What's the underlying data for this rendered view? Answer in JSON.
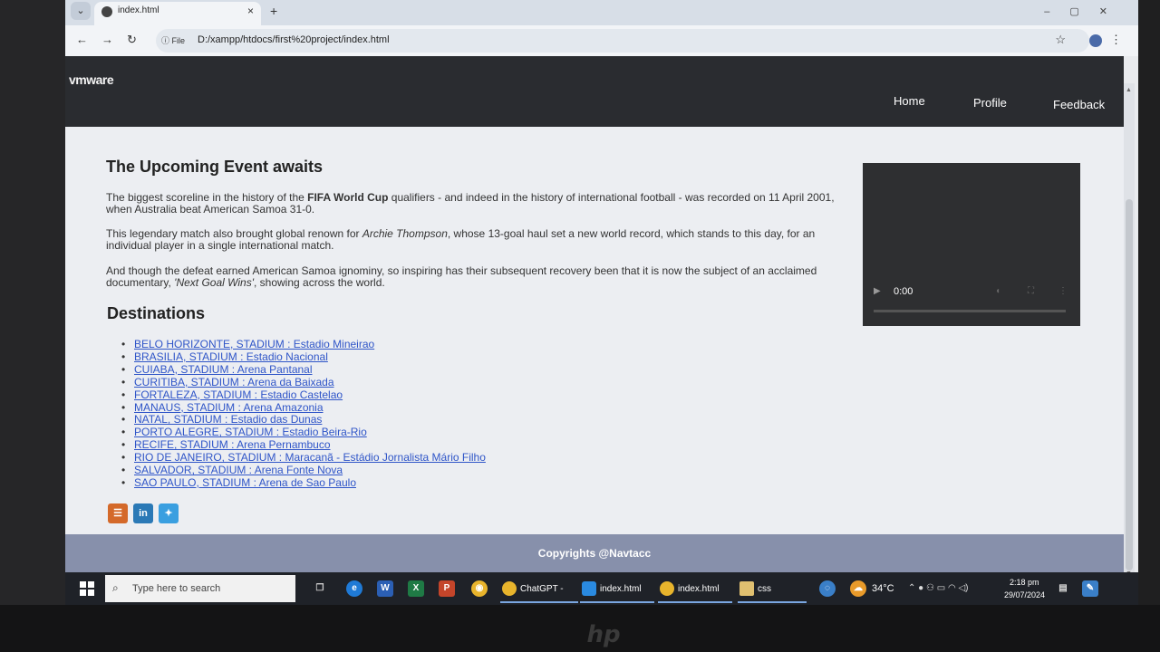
{
  "browser": {
    "tab_title": "index.html",
    "new_tab": "+",
    "close_tab": "×",
    "site_info": "File",
    "url": "D:/xampp/htdocs/first%20project/index.html"
  },
  "site": {
    "brand": "vmware",
    "nav": [
      "Home",
      "Profile",
      "Feedback"
    ],
    "event_title": "The Upcoming Event awaits",
    "para1_a": "The biggest scoreline in the history of the ",
    "para1_b": "FIFA World Cup",
    "para1_c": " qualifiers - and indeed in the history of international football - was recorded on 11 April 2001, when Australia beat American Samoa 31-0.",
    "para2_a": "This legendary match also brought global renown for ",
    "para2_b": "Archie Thompson",
    "para2_c": ", whose 13-goal haul set a new world record, which stands to this day, for an individual player in a single international match.",
    "para3_a": "And though the defeat earned American Samoa ignominy, so inspiring has their subsequent recovery been that it is now the subject of an acclaimed documentary, ",
    "para3_b": "'Next Goal Wins'",
    "para3_c": ", showing across the world.",
    "dest_title": "Destinations",
    "destinations": [
      "BELO HORIZONTE, STADIUM : Estadio Mineirao",
      "BRASILIA, STADIUM : Estadio Nacional",
      "CUIABA, STADIUM : Arena Pantanal",
      "CURITIBA, STADIUM : Arena da Baixada",
      "FORTALEZA, STADIUM : Estadio Castelao",
      "MANAUS, STADIUM : Arena Amazonia",
      "NATAL, STADIUM : Estadio das Dunas",
      "PORTO ALEGRE, STADIUM : Estadio Beira-Rio",
      "RECIFE, STADIUM : Arena Pernambuco",
      "RIO DE JANEIRO, STADIUM : Maracanã - Estádio Jornalista Mário Filho",
      "SALVADOR, STADIUM : Arena Fonte Nova",
      "SAO PAULO, STADIUM : Arena de Sao Paulo"
    ],
    "social": [
      "rss-icon",
      "linkedin-icon",
      "twitter-icon"
    ],
    "video_time": "0:00",
    "footer": "Copyrights @Navtacc"
  },
  "taskbar": {
    "search_placeholder": "Type here to search",
    "apps": [
      "ChatGPT - G...",
      "index.html -...",
      "index.html -...",
      "css"
    ],
    "temperature": "34°C",
    "time": "2:18 pm",
    "date": "29/07/2024"
  },
  "colors": {
    "nav_bg": "#2a2c30",
    "link": "#2f55c8",
    "footer_bg": "#8790ab",
    "taskbar_bg": "#1f2228"
  }
}
